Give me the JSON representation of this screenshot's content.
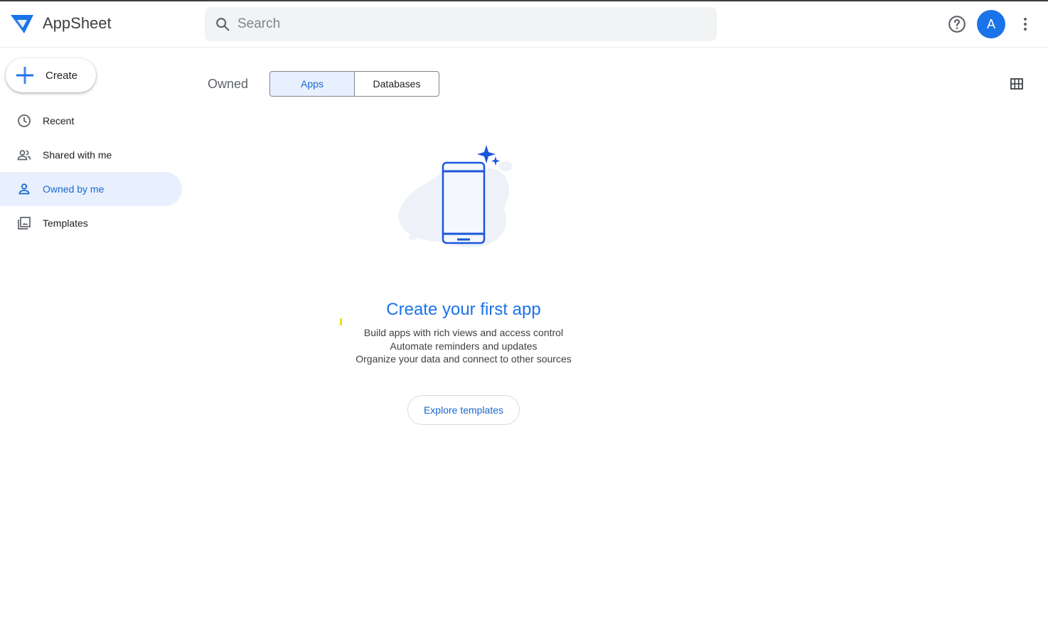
{
  "header": {
    "app_name": "AppSheet",
    "search_placeholder": "Search",
    "avatar_initial": "A"
  },
  "sidebar": {
    "create_label": "Create",
    "items": [
      {
        "label": "Recent",
        "icon": "clock-icon",
        "active": false
      },
      {
        "label": "Shared with me",
        "icon": "people-icon",
        "active": false
      },
      {
        "label": "Owned by me",
        "icon": "person-icon",
        "active": true
      },
      {
        "label": "Templates",
        "icon": "templates-icon",
        "active": false
      }
    ]
  },
  "main": {
    "section_label": "Owned",
    "tabs": [
      {
        "label": "Apps",
        "selected": true
      },
      {
        "label": "Databases",
        "selected": false
      }
    ],
    "empty_state": {
      "title": "Create your first app",
      "lines": [
        "Build apps with rich views and access control",
        "Automate reminders and updates",
        "Organize your data and connect to other sources"
      ],
      "button_label": "Explore templates"
    }
  },
  "colors": {
    "accent": "#1a73e8",
    "active_bg": "#e8f0fe",
    "active_text": "#1967d2"
  }
}
